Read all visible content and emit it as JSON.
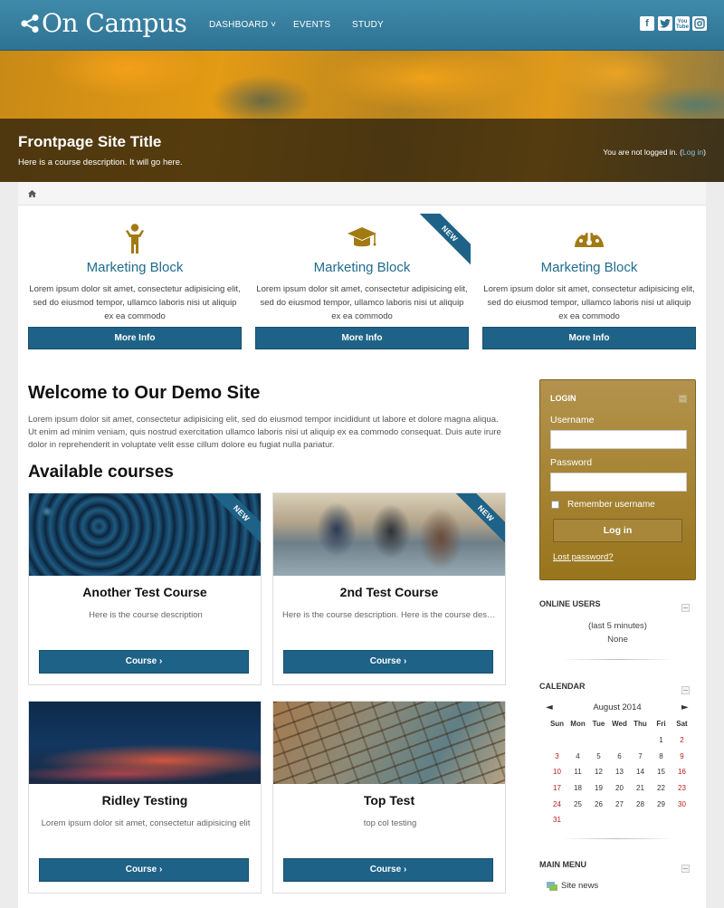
{
  "header": {
    "brand": "On Campus",
    "nav": [
      "DASHBOARD",
      "EVENTS",
      "STUDY"
    ],
    "dashboard_caret": "˅",
    "social": [
      "f",
      "t",
      "You Tube",
      "ig"
    ]
  },
  "hero": {
    "title": "Frontpage Site Title",
    "description": "Here is a course description. It will go here.",
    "login_status": "You are not logged in.",
    "login_link": "Log in"
  },
  "marketing": [
    {
      "icon": "person-icon",
      "title": "Marketing Block",
      "text": "Lorem ipsum dolor sit amet, consectetur adipisicing elit, sed do eiusmod tempor, ullamco laboris nisi ut aliquip ex ea commodo",
      "button": "More Info",
      "ribbon": ""
    },
    {
      "icon": "graduation-cap-icon",
      "title": "Marketing Block",
      "text": "Lorem ipsum dolor sit amet, consectetur adipisicing elit, sed do eiusmod tempor, ullamco laboris nisi ut aliquip ex ea commodo",
      "button": "More Info",
      "ribbon": "NEW"
    },
    {
      "icon": "dashboard-gauge-icon",
      "title": "Marketing Block",
      "text": "Lorem ipsum dolor sit amet, consectetur adipisicing elit, sed do eiusmod tempor, ullamco laboris nisi ut aliquip ex ea commodo",
      "button": "More Info",
      "ribbon": ""
    }
  ],
  "welcome": {
    "heading": "Welcome to Our Demo Site",
    "text": "Lorem ipsum dolor sit amet, consectetur adipisicing elit, sed do eiusmod tempor incididunt ut labore et dolore magna aliqua. Ut enim ad minim veniam, quis nostrud exercitation ullamco laboris nisi ut aliquip ex ea commodo consequat. Duis aute irure dolor in reprehenderit in voluptate velit esse cillum dolore eu fugiat nulla pariatur."
  },
  "courses": {
    "heading": "Available courses",
    "items": [
      {
        "title": "Another Test Course",
        "description": "Here is the course description",
        "button": "Course ›",
        "ribbon": "NEW"
      },
      {
        "title": "2nd Test Course",
        "description": "Here is the course description. Here is the course description.",
        "button": "Course ›",
        "ribbon": "NEW"
      },
      {
        "title": "Ridley Testing",
        "description": "Lorem ipsum dolor sit amet, consectetur adipisicing elit",
        "button": "Course ›",
        "ribbon": ""
      },
      {
        "title": "Top Test",
        "description": "top col testing",
        "button": "Course ›",
        "ribbon": ""
      }
    ]
  },
  "login_block": {
    "heading": "LOGIN",
    "username_label": "Username",
    "password_label": "Password",
    "remember": "Remember username",
    "button": "Log in",
    "lost": "Lost password?"
  },
  "online_users": {
    "heading": "ONLINE USERS",
    "period": "(last 5 minutes)",
    "value": "None"
  },
  "calendar": {
    "heading": "CALENDAR",
    "prev": "◄",
    "next": "►",
    "month": "August 2014",
    "weekdays": [
      "Sun",
      "Mon",
      "Tue",
      "Wed",
      "Thu",
      "Fri",
      "Sat"
    ],
    "weeks": [
      [
        "",
        "",
        "",
        "",
        "",
        "1",
        "2"
      ],
      [
        "3",
        "4",
        "5",
        "6",
        "7",
        "8",
        "9"
      ],
      [
        "10",
        "11",
        "12",
        "13",
        "14",
        "15",
        "16"
      ],
      [
        "17",
        "18",
        "19",
        "20",
        "21",
        "22",
        "23"
      ],
      [
        "24",
        "25",
        "26",
        "27",
        "28",
        "29",
        "30"
      ],
      [
        "31",
        "",
        "",
        "",
        "",
        "",
        ""
      ]
    ]
  },
  "main_menu": {
    "heading": "MAIN MENU",
    "items": [
      "Site news"
    ]
  },
  "colors": {
    "navbar": "#2f7293",
    "accent_blue": "#1e6287",
    "login_gold": "#a8873a",
    "marketing_icon": "#a37a12",
    "weekend_red": "#b81c1c"
  }
}
